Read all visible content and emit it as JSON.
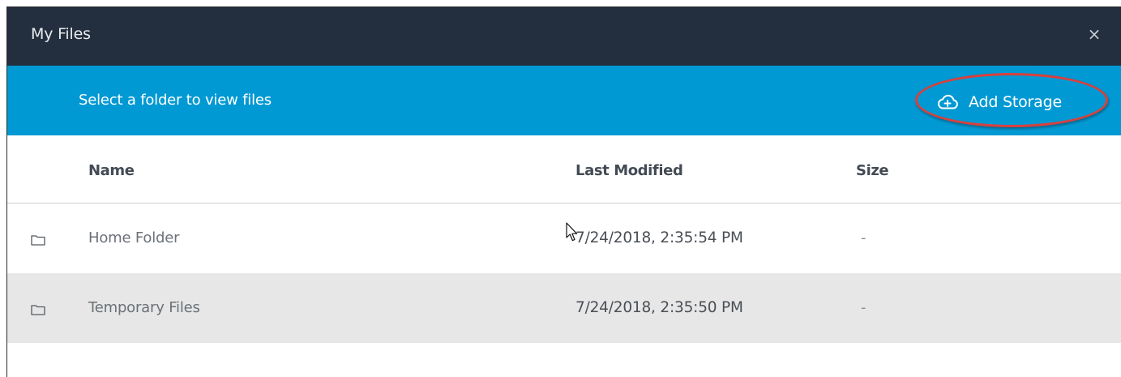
{
  "dialog": {
    "title": "My Files",
    "close_glyph": "×",
    "close_icon": "close-icon"
  },
  "toolbar": {
    "subtitle": "Select a folder to view files",
    "add_storage_label": "Add Storage",
    "add_storage_icon": "cloud-upload-icon",
    "highlight_color": "#d9403c"
  },
  "table": {
    "columns": [
      "Name",
      "Last Modified",
      "Size"
    ],
    "rows": [
      {
        "icon": "folder-icon",
        "name": "Home Folder",
        "modified": "7/24/2018, 2:35:54 PM",
        "size": "-"
      },
      {
        "icon": "folder-icon",
        "name": "Temporary Files",
        "modified": "7/24/2018, 2:35:50 PM",
        "size": "-"
      }
    ]
  },
  "colors": {
    "titlebar_bg": "#232f3e",
    "toolbar_bg": "#0099d4",
    "alt_row_bg": "#e7e7e7"
  }
}
